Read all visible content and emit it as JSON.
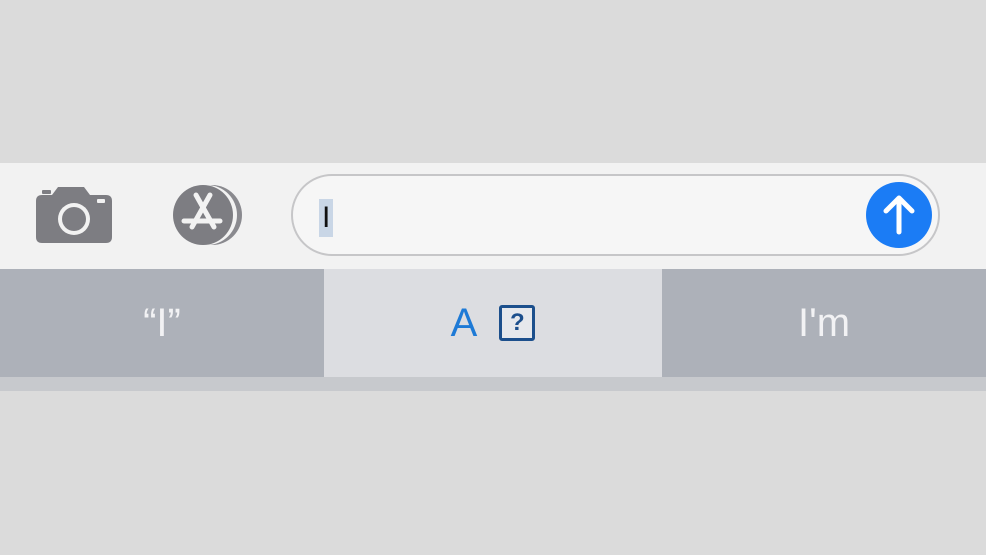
{
  "toolbar": {
    "camera_icon": "camera-icon",
    "apps_icon": "app-store-icon"
  },
  "message": {
    "text": "I",
    "send_icon": "arrow-up-icon"
  },
  "suggestions": {
    "left": "“I”",
    "middle_text": "A",
    "middle_box": "?",
    "right": "I'm"
  },
  "colors": {
    "accent": "#1b7cf5",
    "suggestion_text": "#1e7ad6"
  }
}
